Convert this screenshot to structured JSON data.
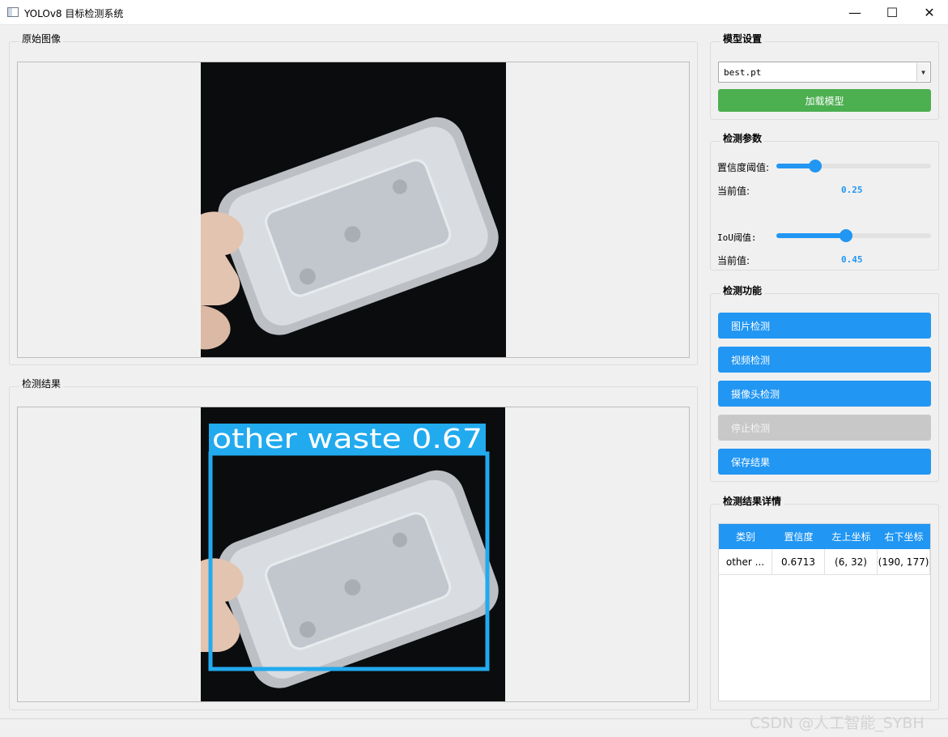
{
  "window": {
    "title": "YOLOv8 目标检测系统",
    "controls": {
      "minimize": "—",
      "maximize": "☐",
      "close": "✕"
    }
  },
  "panels": {
    "original": {
      "title": "原始图像"
    },
    "result": {
      "title": "检测结果",
      "box_label": "other waste 0.67",
      "box_color": "#22aaee"
    }
  },
  "model_settings": {
    "title": "模型设置",
    "model_select": {
      "value": "best.pt"
    },
    "load_button": "加载模型"
  },
  "detect_params": {
    "title": "检测参数",
    "confidence": {
      "label": "置信度阈值:",
      "current_label": "当前值:",
      "value": 0.25,
      "display": "0.25"
    },
    "iou": {
      "label": "IoU阈值:",
      "current_label": "当前值:",
      "value": 0.45,
      "display": "0.45"
    }
  },
  "detect_functions": {
    "title": "检测功能",
    "buttons": {
      "image": "图片检测",
      "video": "视频检测",
      "camera": "摄像头检测",
      "stop": "停止检测",
      "save": "保存结果"
    }
  },
  "result_details": {
    "title": "检测结果详情",
    "columns": [
      "类别",
      "置信度",
      "左上坐标",
      "右下坐标"
    ],
    "rows": [
      [
        "other ...",
        "0.6713",
        "(6, 32)",
        "(190, 177)"
      ]
    ]
  },
  "watermark": "CSDN @人工智能_SYBH",
  "colors": {
    "accent": "#2196f3",
    "load": "#4caf50",
    "disabled": "#c8c8c8"
  }
}
